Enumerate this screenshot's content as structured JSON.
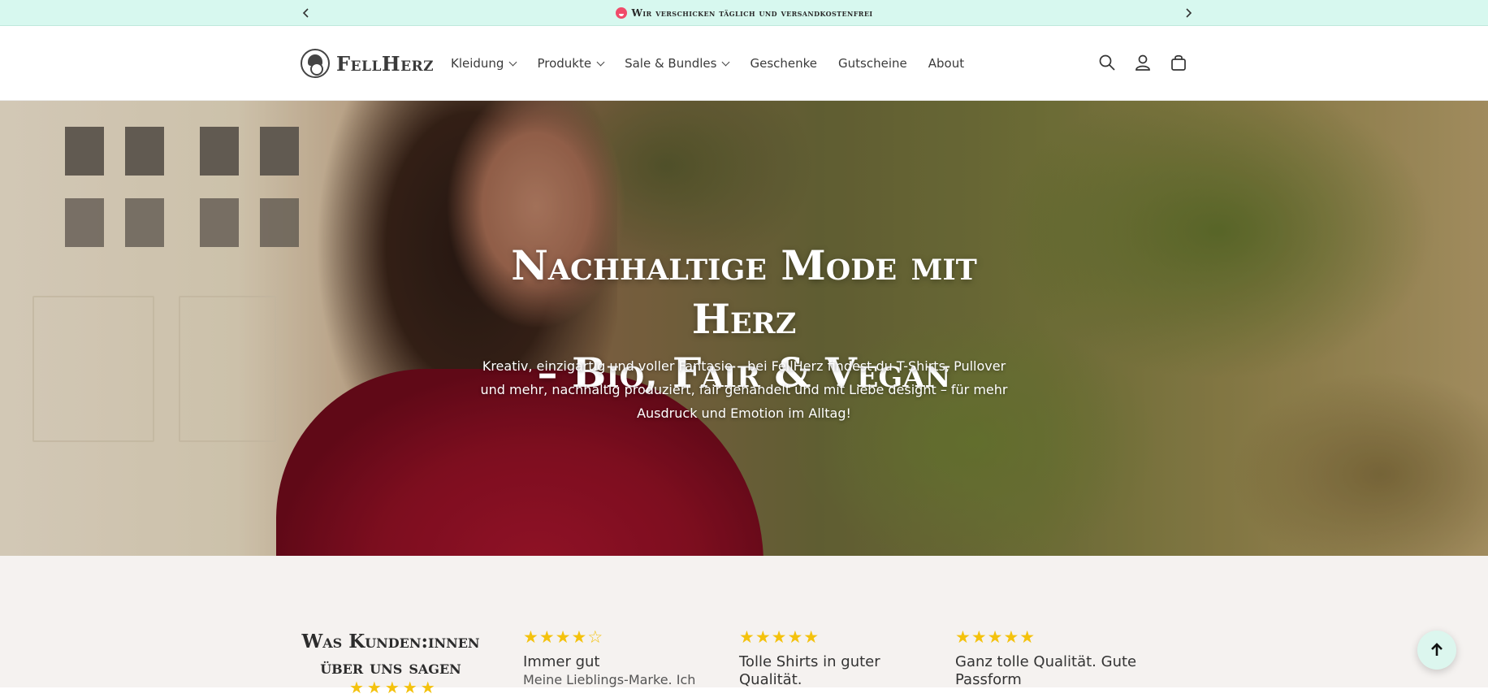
{
  "announcement": {
    "text": "Wir verschicken täglich und versandkostenfrei",
    "prev_icon": "chevron-left-icon",
    "next_icon": "chevron-right-icon"
  },
  "header": {
    "logo_text": "FellHerz",
    "nav": [
      {
        "label": "Kleidung",
        "dropdown": true
      },
      {
        "label": "Produkte",
        "dropdown": true
      },
      {
        "label": "Sale & Bundles",
        "dropdown": true
      },
      {
        "label": "Geschenke",
        "dropdown": false
      },
      {
        "label": "Gutscheine",
        "dropdown": false
      },
      {
        "label": "About",
        "dropdown": false
      }
    ],
    "icons": [
      "search-icon",
      "account-icon",
      "cart-icon"
    ]
  },
  "hero": {
    "title_line1": "Nachhaltige Mode mit Herz",
    "title_line2": "– Bio, Fair & Vegan",
    "subtitle": "Kreativ, einzigartig und voller Fantasie – bei FellHerz findest du T-Shirts, Pullover und mehr, nachhaltig produziert, fair gehandelt und mit Liebe designt – für mehr Ausdruck und Emotion im Alltag!"
  },
  "reviews": {
    "heading": "Was Kunden:innen über uns sagen",
    "items": [
      {
        "rating": 4,
        "title": "Immer gut",
        "body": "Meine Lieblings-Marke. Ich"
      },
      {
        "rating": 5,
        "title": "Tolle Shirts in guter Qualität.",
        "body": ""
      },
      {
        "rating": 5,
        "title": "Ganz tolle Qualität. Gute Passform",
        "body": ""
      }
    ]
  },
  "colors": {
    "announcement_bg": "#d7f8ef",
    "star": "#f4c20d",
    "reviews_bg": "#f5f2f0"
  },
  "back_to_top_icon": "arrow-up-icon"
}
